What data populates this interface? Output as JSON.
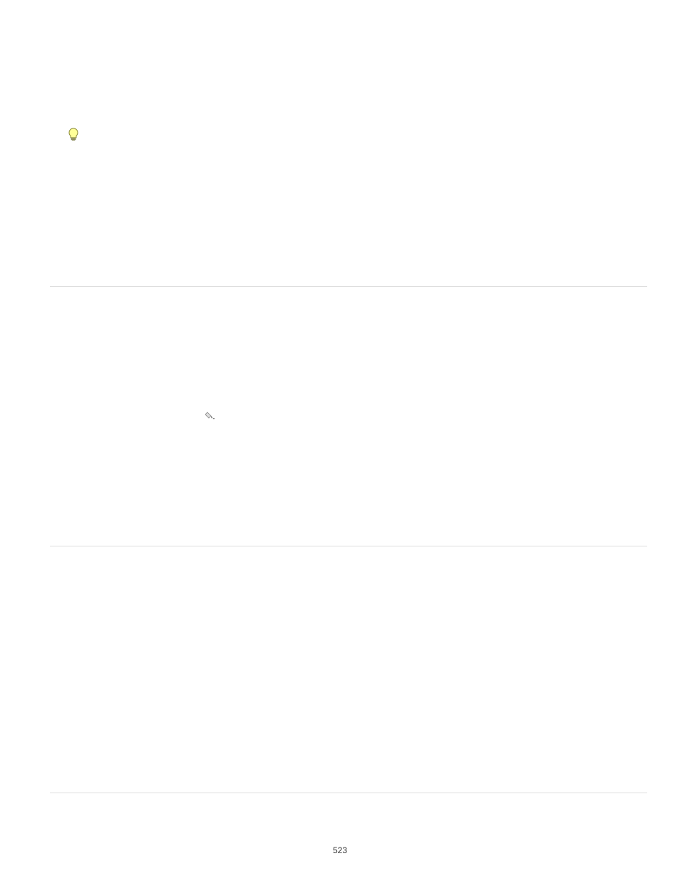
{
  "page_number": "523"
}
